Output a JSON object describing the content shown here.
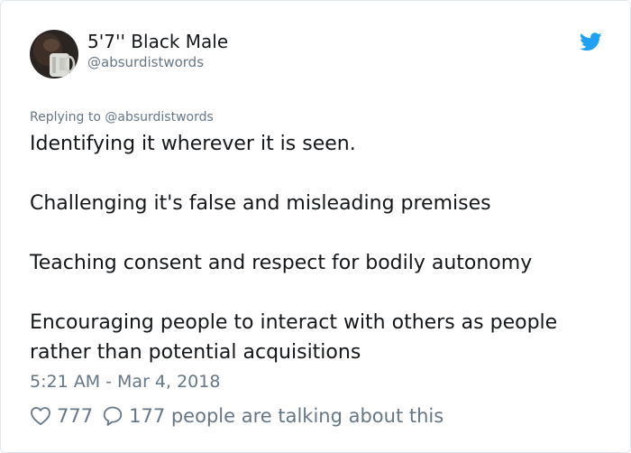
{
  "author": {
    "display_name": "5'7'' Black Male",
    "handle": "@absurdistwords"
  },
  "icons": {
    "platform": "twitter-bird-icon",
    "like": "heart-outline-icon",
    "reply": "speech-bubble-icon"
  },
  "colors": {
    "brand_blue": "#1da1f2",
    "secondary_text": "#657786",
    "primary_text": "#14171a"
  },
  "reply_context": {
    "prefix": "Replying to",
    "handle": "@absurdistwords"
  },
  "tweet": {
    "paragraphs": [
      "Identifying it wherever it is seen.",
      "Challenging it's false and misleading premises",
      "Teaching consent and respect for bodily autonomy",
      "Encouraging people to interact with others as people rather than potential acquisitions"
    ],
    "timestamp": "5:21 AM - Mar 4, 2018"
  },
  "engagement": {
    "likes": "777",
    "talking_text": "177 people are talking about this"
  }
}
